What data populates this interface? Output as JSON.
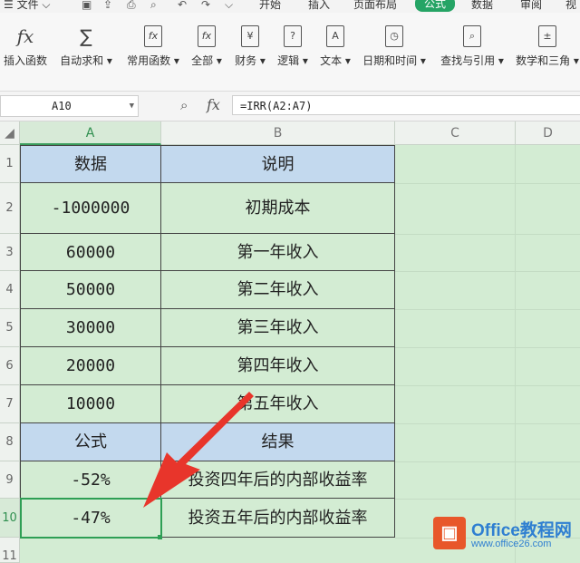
{
  "menubar": {
    "file": "文件",
    "tabs": [
      "开始",
      "插入",
      "页面布局",
      "公式",
      "数据",
      "审阅",
      "视"
    ],
    "active_tab": "公式",
    "active_color": "#25a465"
  },
  "ribbon": {
    "buttons": [
      {
        "label": "插入函数",
        "icon": "fx-icon",
        "glyph": "fx"
      },
      {
        "label": "自动求和",
        "icon": "sum-icon",
        "glyph": "∑"
      },
      {
        "label": "常用函数",
        "icon": "star-function-icon",
        "glyph": "fx"
      },
      {
        "label": "全部",
        "icon": "all-functions-icon",
        "glyph": "fx"
      },
      {
        "label": "财务",
        "icon": "finance-icon",
        "glyph": "¥"
      },
      {
        "label": "逻辑",
        "icon": "logic-icon",
        "glyph": "?"
      },
      {
        "label": "文本",
        "icon": "text-icon",
        "glyph": "A"
      },
      {
        "label": "日期和时间",
        "icon": "clock-icon",
        "glyph": "◷"
      },
      {
        "label": "查找与引用",
        "icon": "lookup-icon",
        "glyph": "⌕"
      },
      {
        "label": "数学和三角",
        "icon": "math-icon",
        "glyph": "±"
      }
    ]
  },
  "formula_bar": {
    "name_box": "A10",
    "fx": "fx",
    "formula": "=IRR(A2:A7)"
  },
  "sheet": {
    "columns": [
      "A",
      "B",
      "C",
      "D"
    ],
    "rows": [
      "1",
      "2",
      "3",
      "4",
      "5",
      "6",
      "7",
      "8",
      "9",
      "10",
      "11"
    ],
    "cells": [
      {
        "a": "数据",
        "b": "说明"
      },
      {
        "a": "-1000000",
        "b": "初期成本"
      },
      {
        "a": "60000",
        "b": "第一年收入"
      },
      {
        "a": "50000",
        "b": "第二年收入"
      },
      {
        "a": "30000",
        "b": "第三年收入"
      },
      {
        "a": "20000",
        "b": "第四年收入"
      },
      {
        "a": "10000",
        "b": "第五年收入"
      },
      {
        "a": "公式",
        "b": "结果"
      },
      {
        "a": "-52%",
        "b": "投资四年后的内部收益率"
      },
      {
        "a": "-47%",
        "b": "投资五年后的内部收益率"
      }
    ],
    "selected_cell": "A10",
    "header_fill": "#c3d9ee",
    "sheet_fill": "#d3ecd3",
    "arrow_color": "#e8352b"
  },
  "watermark": {
    "title": "Office教程网",
    "url": "www.office26.com",
    "logo_color": "#e8572a",
    "text_color": "#2f7fd1"
  }
}
